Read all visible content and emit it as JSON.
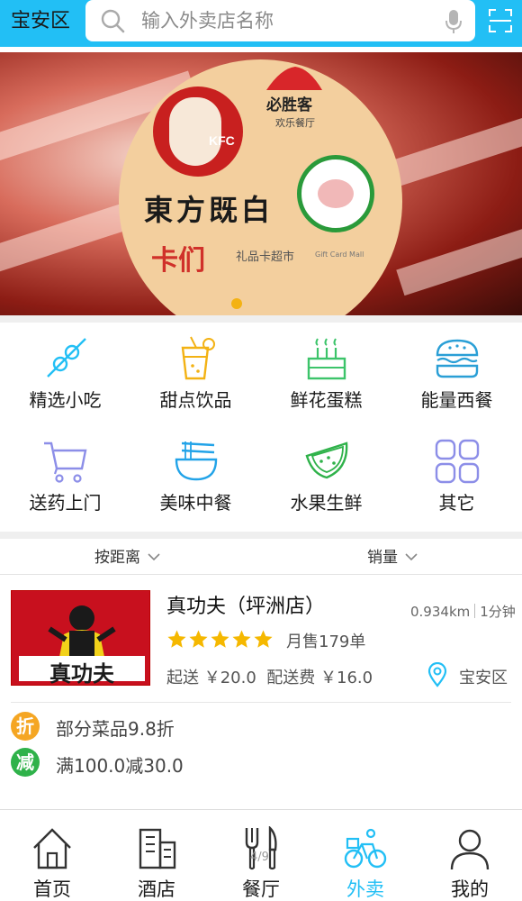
{
  "header": {
    "region": "宝安区",
    "search_placeholder": "输入外卖店名称",
    "icons": [
      "search-icon",
      "mic-icon",
      "scan-icon"
    ],
    "accent_color": "#22bff5"
  },
  "banner": {
    "brand_kfc": "KFC",
    "brand_pizza": "必胜客",
    "brand_pizza_sub": "欢乐餐厅",
    "brand_dongfang": "東方既白",
    "brand_kamen": "卡们",
    "giftcard": "礼品卡超市",
    "giftcard_en": "Gift Card Mall",
    "active_dot_color": "#f3b214"
  },
  "categories": [
    {
      "label": "精选小吃",
      "icon": "skewer-icon"
    },
    {
      "label": "甜点饮品",
      "icon": "drink-icon"
    },
    {
      "label": "鲜花蛋糕",
      "icon": "cake-icon"
    },
    {
      "label": "能量西餐",
      "icon": "burger-icon"
    },
    {
      "label": "送药上门",
      "icon": "cart-icon"
    },
    {
      "label": "美味中餐",
      "icon": "bowl-icon"
    },
    {
      "label": "水果生鲜",
      "icon": "watermelon-icon"
    },
    {
      "label": "其它",
      "icon": "grid-icon"
    }
  ],
  "sort": {
    "distance": "按距离",
    "sales": "销量"
  },
  "store": {
    "name": "真功夫（坪洲店）",
    "distance": "0.934km",
    "time": "1分钟",
    "rating": 5,
    "monthly_sales": "月售179单",
    "min_order": "起送 ￥20.0",
    "delivery_fee": "配送费 ￥16.0",
    "district": "宝安区",
    "logo_text": "真功夫",
    "promos": [
      {
        "badge": "折",
        "text": "部分菜品9.8折",
        "color": "#f5a623"
      },
      {
        "badge": "减",
        "text": "满100.0减30.0",
        "color": "#2fb24a"
      }
    ]
  },
  "tabs": [
    {
      "label": "首页",
      "icon": "home-icon",
      "active": false
    },
    {
      "label": "酒店",
      "icon": "hotel-icon",
      "active": false
    },
    {
      "label": "餐厅",
      "icon": "fork-knife-icon",
      "active": false
    },
    {
      "label": "外卖",
      "icon": "bike-icon",
      "active": true
    },
    {
      "label": "我的",
      "icon": "user-icon",
      "active": false
    }
  ],
  "page_indicator": "4/9"
}
